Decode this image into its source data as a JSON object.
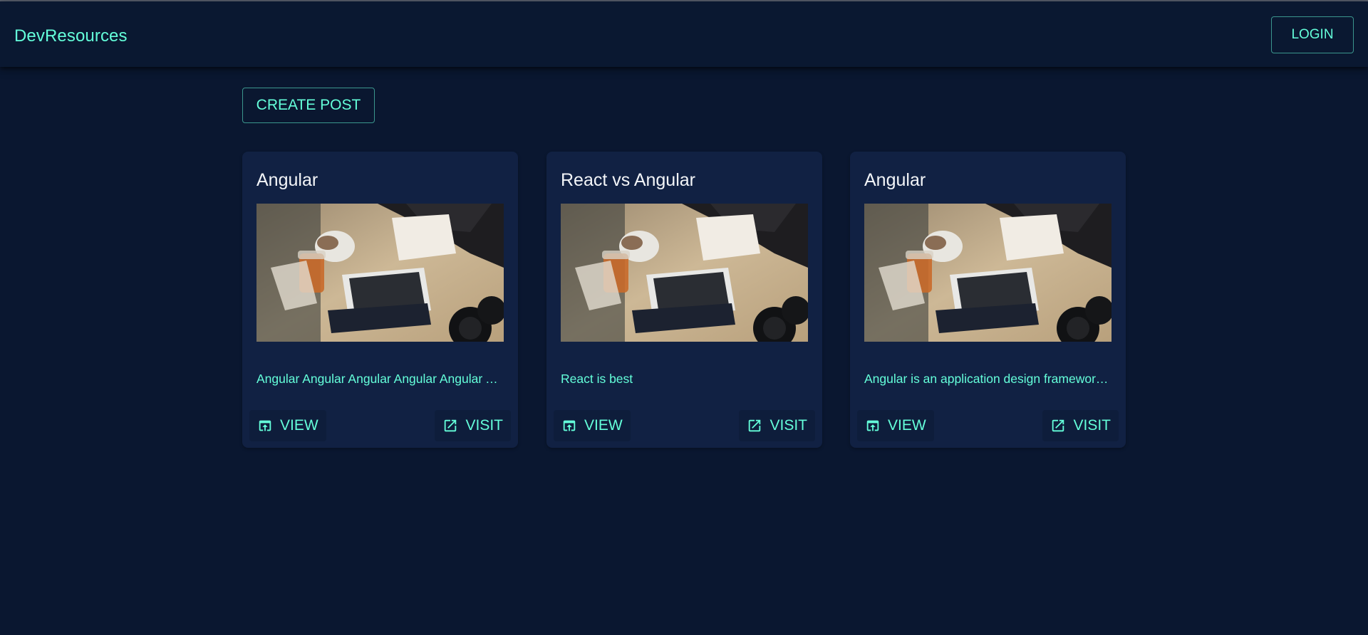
{
  "app": {
    "brand": "DevResources",
    "login_label": "LOGIN"
  },
  "toolbar": {
    "create_label": "CREATE POST"
  },
  "colors": {
    "accent": "#64ffda",
    "background": "#0a1730",
    "card": "#112143"
  },
  "posts": [
    {
      "title": "Angular",
      "description": "Angular Angular Angular Angular Angular Angular Angular",
      "view_label": "VIEW",
      "visit_label": "VISIT",
      "view_icon": "open-in-browser-icon",
      "visit_icon": "open-in-new-icon"
    },
    {
      "title": "React vs Angular",
      "description": "React is best",
      "view_label": "VIEW",
      "visit_label": "VISIT",
      "view_icon": "open-in-browser-icon",
      "visit_icon": "open-in-new-icon"
    },
    {
      "title": "Angular",
      "description": "Angular is an application design framework and development platform",
      "view_label": "VIEW",
      "visit_label": "VISIT",
      "view_icon": "open-in-browser-icon",
      "visit_icon": "open-in-new-icon"
    }
  ]
}
